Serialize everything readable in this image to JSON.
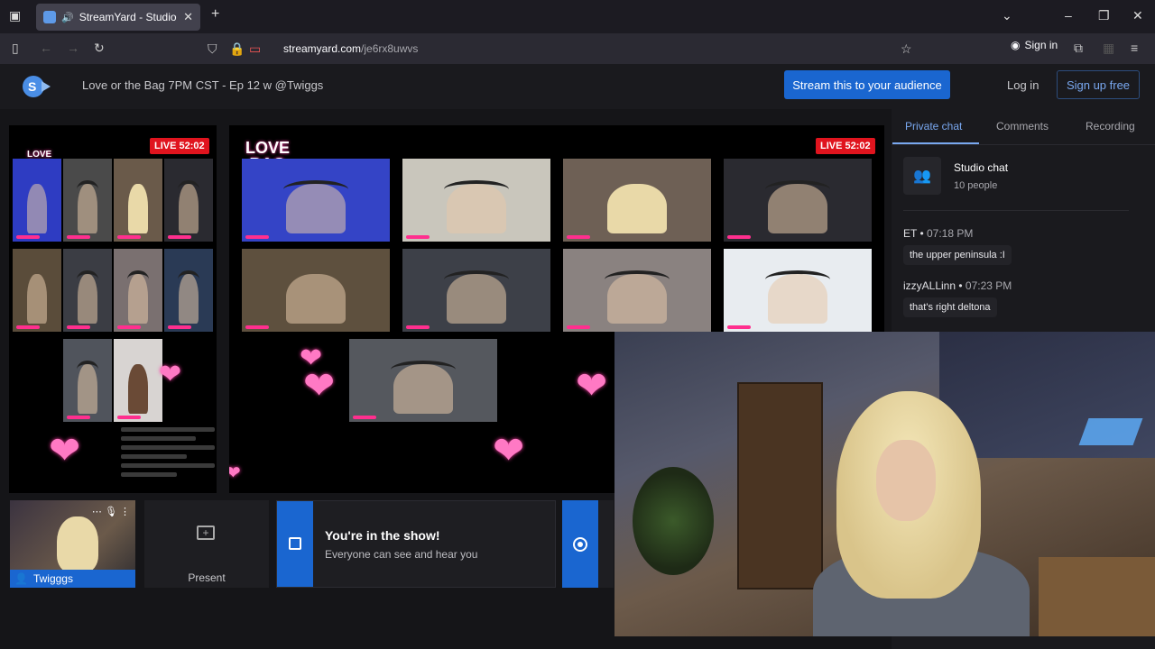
{
  "browser": {
    "tab_title": "StreamYard - Studio",
    "url_host": "streamyard.com",
    "url_path": "/je6rx8uwvs",
    "sign_in": "Sign in"
  },
  "header": {
    "show_title": "Love or the Bag 7PM CST - Ep 12 w @Twiggs",
    "stream_button": "Stream this to your audience",
    "login": "Log in",
    "signup": "Sign up free"
  },
  "stage": {
    "live_preview": "LIVE 52:02",
    "live_main": "LIVE 52:02",
    "logo_line1": "LOVE",
    "logo_line2": "BAG"
  },
  "tray": {
    "self_name": "Twigggs",
    "present_label": "Present",
    "inshow_title": "You're in the show!",
    "inshow_sub": "Everyone can see and hear you"
  },
  "panel": {
    "tabs": [
      "Private chat",
      "Comments",
      "Recording"
    ],
    "chat_name": "Studio chat",
    "chat_count": "10 people",
    "messages": [
      {
        "author": "ET",
        "time": "07:18 PM",
        "text": "the upper peninsula :I"
      },
      {
        "author": "izzyALLinn",
        "time": "07:23 PM",
        "text": "that's right deltona"
      }
    ]
  },
  "colors": {
    "accent": "#1a66d0",
    "live": "#e0141e",
    "link": "#79a8f0"
  }
}
